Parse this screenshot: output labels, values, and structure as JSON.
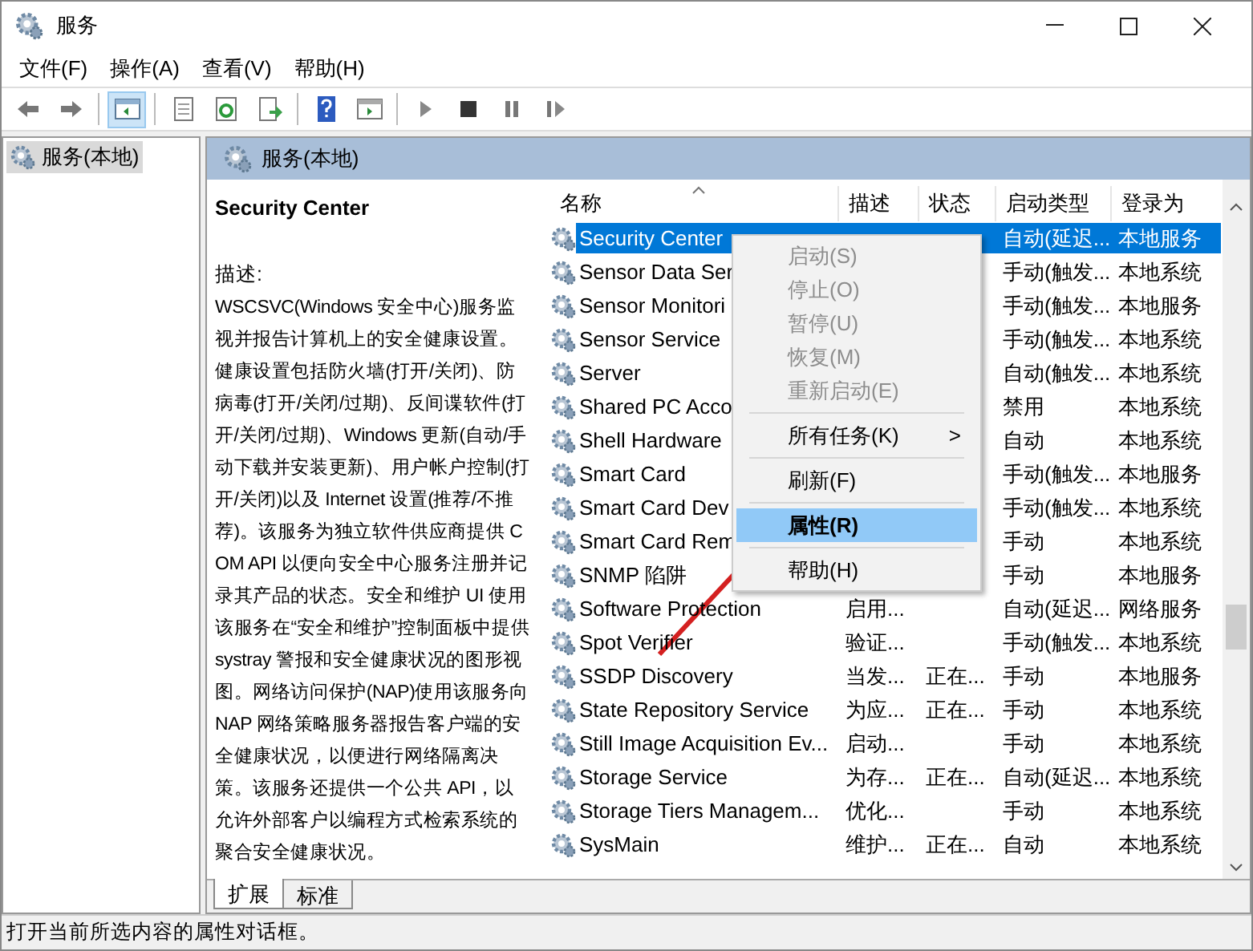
{
  "window": {
    "title": "服务"
  },
  "menu": [
    "文件(F)",
    "操作(A)",
    "查看(V)",
    "帮助(H)"
  ],
  "toolbar": [
    {
      "kind": "back",
      "selected": false
    },
    {
      "kind": "forward",
      "selected": false
    },
    {
      "kind": "sep"
    },
    {
      "kind": "tree",
      "selected": true
    },
    {
      "kind": "sep"
    },
    {
      "kind": "props",
      "selected": false
    },
    {
      "kind": "refresh",
      "selected": false
    },
    {
      "kind": "export",
      "selected": false
    },
    {
      "kind": "sep"
    },
    {
      "kind": "help",
      "selected": false
    },
    {
      "kind": "pane",
      "selected": false
    },
    {
      "kind": "sep"
    },
    {
      "kind": "play",
      "selected": false
    },
    {
      "kind": "stop",
      "selected": false
    },
    {
      "kind": "pause",
      "selected": false
    },
    {
      "kind": "resume",
      "selected": false
    }
  ],
  "tree": [
    {
      "label": "服务(本地)",
      "selected": true
    }
  ],
  "pane_title": "服务(本地)",
  "details": {
    "title": "Security Center",
    "label": "描述:",
    "text": "WSCSVC(Windows 安全中心)服务监视并报告计算机上的安全健康设置。健康设置包括防火墙(打开/关闭)、防病毒(打开/关闭/过期)、反间谍软件(打开/关闭/过期)、Windows 更新(自动/手动下载并安装更新)、用户帐户控制(打开/关闭)以及 Internet 设置(推荐/不推荐)。该服务为独立软件供应商提供 COM API 以便向安全中心服务注册并记录其产品的状态。安全和维护 UI 使用该服务在“安全和维护”控制面板中提供 systray 警报和安全健康状况的图形视图。网络访问保护(NAP)使用该服务向 NAP 网络策略服务器报告客户端的安全健康状况，以便进行网络隔离决策。该服务还提供一个公共 API，以允许外部客户以编程方式检索系统的聚合安全健康状况。"
  },
  "table": {
    "columns": [
      "名称",
      "描述",
      "状态",
      "启动类型",
      "登录为"
    ],
    "rows": [
      {
        "name": "Security Center",
        "startup": "自动(延迟...",
        "logon": "本地服务",
        "selected": true
      },
      {
        "name": "Sensor Data Ser",
        "startup": "手动(触发...",
        "logon": "本地系统",
        "selected": false
      },
      {
        "name": "Sensor Monitori",
        "startup": "手动(触发...",
        "logon": "本地服务",
        "selected": false
      },
      {
        "name": "Sensor Service",
        "startup": "手动(触发...",
        "logon": "本地系统",
        "selected": false
      },
      {
        "name": "Server",
        "startup": "自动(触发...",
        "logon": "本地系统",
        "selected": false
      },
      {
        "name": "Shared PC Acco",
        "startup": "禁用",
        "logon": "本地系统",
        "selected": false
      },
      {
        "name": "Shell Hardware",
        "startup": "自动",
        "logon": "本地系统",
        "selected": false
      },
      {
        "name": "Smart Card",
        "startup": "手动(触发...",
        "logon": "本地服务",
        "selected": false
      },
      {
        "name": "Smart Card Dev",
        "startup": "手动(触发...",
        "logon": "本地系统",
        "selected": false
      },
      {
        "name": "Smart Card Rem",
        "startup": "手动",
        "logon": "本地系统",
        "selected": false
      },
      {
        "name": "SNMP 陷阱",
        "startup": "手动",
        "logon": "本地服务",
        "selected": false
      },
      {
        "name": "Software Protection",
        "desc": "启用...",
        "startup": "自动(延迟...",
        "logon": "网络服务",
        "selected": false
      },
      {
        "name": "Spot Verifier",
        "desc": "验证...",
        "startup": "手动(触发...",
        "logon": "本地系统",
        "selected": false
      },
      {
        "name": "SSDP Discovery",
        "desc": "当发...",
        "status": "正在...",
        "startup": "手动",
        "logon": "本地服务",
        "selected": false
      },
      {
        "name": "State Repository Service",
        "desc": "为应...",
        "status": "正在...",
        "startup": "手动",
        "logon": "本地系统",
        "selected": false
      },
      {
        "name": "Still Image Acquisition Ev...",
        "desc": "启动...",
        "startup": "手动",
        "logon": "本地系统",
        "selected": false
      },
      {
        "name": "Storage Service",
        "desc": "为存...",
        "status": "正在...",
        "startup": "自动(延迟...",
        "logon": "本地系统",
        "selected": false
      },
      {
        "name": "Storage Tiers Managem...",
        "desc": "优化...",
        "startup": "手动",
        "logon": "本地系统",
        "selected": false
      },
      {
        "name": "SysMain",
        "desc": "维护...",
        "status": "正在...",
        "startup": "自动",
        "logon": "本地系统",
        "selected": false
      }
    ]
  },
  "context_menu": [
    {
      "kind": "item",
      "label": "启动(S)",
      "disabled": true,
      "selected": false
    },
    {
      "kind": "item",
      "label": "停止(O)",
      "disabled": true,
      "selected": false
    },
    {
      "kind": "item",
      "label": "暂停(U)",
      "disabled": true,
      "selected": false
    },
    {
      "kind": "item",
      "label": "恢复(M)",
      "disabled": true,
      "selected": false
    },
    {
      "kind": "item",
      "label": "重新启动(E)",
      "disabled": true,
      "selected": false
    },
    {
      "kind": "sep"
    },
    {
      "kind": "submenu",
      "label": "所有任务(K)",
      "arrow": ">",
      "disabled": false,
      "selected": false
    },
    {
      "kind": "sep"
    },
    {
      "kind": "item",
      "label": "刷新(F)",
      "disabled": false,
      "selected": false
    },
    {
      "kind": "sep"
    },
    {
      "kind": "item",
      "label": "属性(R)",
      "disabled": false,
      "selected": true
    },
    {
      "kind": "sep"
    },
    {
      "kind": "item",
      "label": "帮助(H)",
      "disabled": false,
      "selected": false
    }
  ],
  "bottom_tabs": [
    {
      "label": "扩展",
      "selected": true
    },
    {
      "label": "标准",
      "selected": false
    }
  ],
  "status_bar": "打开当前所选内容的属性对话框。"
}
